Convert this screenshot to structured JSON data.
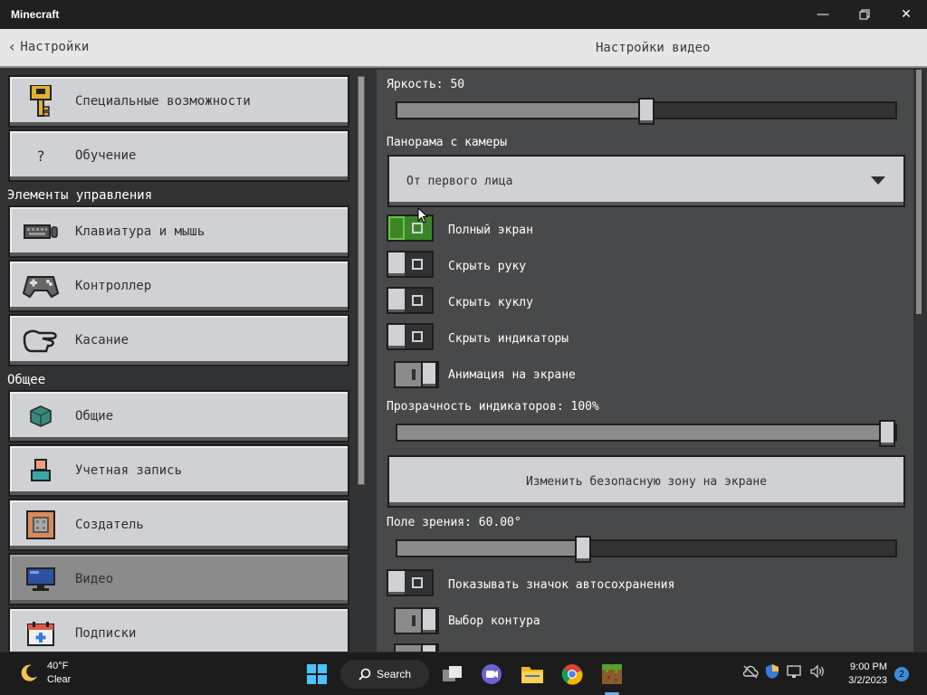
{
  "window": {
    "title": "Minecraft"
  },
  "header": {
    "back_label": "Настройки",
    "title": "Настройки видео"
  },
  "sidebar": {
    "items_top": [
      {
        "label": "Специальные возможности",
        "icon": "key-icon"
      },
      {
        "label": "Обучение",
        "icon": "question-icon"
      }
    ],
    "section_controls": "Элементы управления",
    "items_controls": [
      {
        "label": "Клавиатура и мышь",
        "icon": "keyboard-icon"
      },
      {
        "label": "Контроллер",
        "icon": "gamepad-icon"
      },
      {
        "label": "Касание",
        "icon": "touch-icon"
      }
    ],
    "section_general": "Общее",
    "items_general": [
      {
        "label": "Общие",
        "icon": "cube-icon"
      },
      {
        "label": "Учетная запись",
        "icon": "account-icon"
      },
      {
        "label": "Создатель",
        "icon": "creator-icon"
      },
      {
        "label": "Видео",
        "icon": "monitor-icon",
        "active": true
      },
      {
        "label": "Подписки",
        "icon": "calendar-icon"
      }
    ]
  },
  "settings": {
    "brightness": {
      "label": "Яркость: 50",
      "value": 0.5
    },
    "camera": {
      "label": "Панорама с камеры",
      "value": "От первого лица"
    },
    "fullscreen": {
      "label": "Полный экран",
      "on": true
    },
    "hide_hand": {
      "label": "Скрыть руку",
      "on": false
    },
    "hide_doll": {
      "label": "Скрыть куклу",
      "on": false
    },
    "hide_hud": {
      "label": "Скрыть индикаторы",
      "on": false
    },
    "screen_animation": {
      "label": "Анимация на экране",
      "on": true
    },
    "hud_opacity": {
      "label": "Прозрачность индикаторов: 100%",
      "value": 1.0
    },
    "safe_zone_button": "Изменить безопасную зону на экране",
    "fov": {
      "label": "Поле зрения: 60.00°",
      "value": 0.375
    },
    "autosave_icon": {
      "label": "Показывать значок автосохранения",
      "on": false
    },
    "outline_selection": {
      "label": "Выбор контура",
      "on": true
    }
  },
  "taskbar": {
    "weather_temp": "40°F",
    "weather_desc": "Clear",
    "search_label": "Search",
    "time": "9:00 PM",
    "date": "3/2/2023",
    "notifications": "2"
  },
  "colors": {
    "accent_green": "#3c8527",
    "panel": "#48494a",
    "button": "#d0d1d4"
  }
}
